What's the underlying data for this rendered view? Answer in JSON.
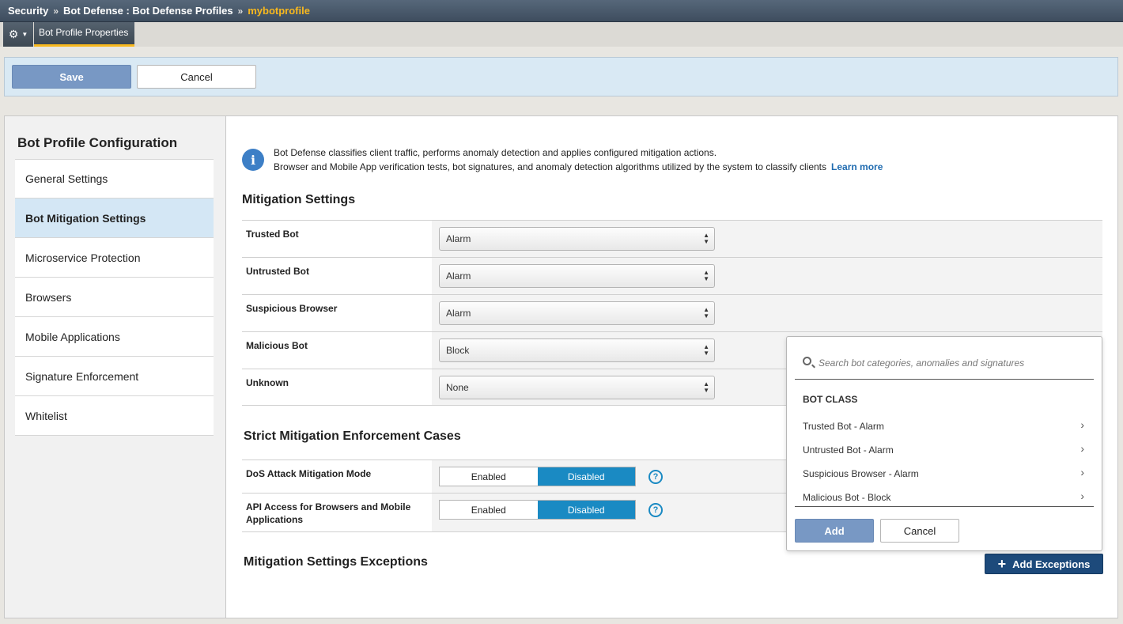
{
  "breadcrumb": {
    "items": [
      "Security",
      "Bot Defense : Bot Defense Profiles"
    ],
    "separator": "»",
    "current": "mybotprofile"
  },
  "tabs": {
    "gear_icon": "gear-icon",
    "active_tab": "Bot Profile Properties"
  },
  "actions": {
    "save": "Save",
    "cancel": "Cancel"
  },
  "sidebar": {
    "title": "Bot Profile Configuration",
    "items": [
      {
        "label": "General Settings",
        "active": false
      },
      {
        "label": "Bot Mitigation Settings",
        "active": true
      },
      {
        "label": "Microservice Protection",
        "active": false
      },
      {
        "label": "Browsers",
        "active": false
      },
      {
        "label": "Mobile Applications",
        "active": false
      },
      {
        "label": "Signature Enforcement",
        "active": false
      },
      {
        "label": "Whitelist",
        "active": false
      }
    ]
  },
  "info": {
    "line1": "Bot Defense classifies client traffic, performs anomaly detection and applies configured mitigation actions.",
    "line2": "Browser and Mobile App verification tests, bot signatures, and anomaly detection algorithms utilized by the system to classify clients",
    "learn_more": "Learn more"
  },
  "mitigation": {
    "title": "Mitigation Settings",
    "rows": [
      {
        "label": "Trusted Bot",
        "value": "Alarm"
      },
      {
        "label": "Untrusted Bot",
        "value": "Alarm"
      },
      {
        "label": "Suspicious Browser",
        "value": "Alarm"
      },
      {
        "label": "Malicious Bot",
        "value": "Block"
      },
      {
        "label": "Unknown",
        "value": "None"
      }
    ]
  },
  "strict": {
    "title": "Strict Mitigation Enforcement Cases",
    "rows": [
      {
        "label": "DoS Attack Mitigation Mode",
        "enabled": "Enabled",
        "disabled": "Disabled",
        "selected": "Disabled"
      },
      {
        "label": "API Access for Browsers and Mobile Applications",
        "enabled": "Enabled",
        "disabled": "Disabled",
        "selected": "Disabled"
      }
    ]
  },
  "exceptions": {
    "title": "Mitigation Settings Exceptions",
    "add_button": "Add Exceptions"
  },
  "popover": {
    "search_placeholder": "Search bot categories, anomalies and signatures",
    "heading": "BOT CLASS",
    "items": [
      "Trusted Bot - Alarm",
      "Untrusted Bot - Alarm",
      "Suspicious Browser - Alarm",
      "Malicious Bot - Block"
    ],
    "add": "Add",
    "cancel": "Cancel"
  },
  "colors": {
    "accent": "#f8b81e",
    "toggle_on": "#1a8ac3",
    "primary_button": "#7898c4",
    "dark_button": "#1d4a7b"
  }
}
